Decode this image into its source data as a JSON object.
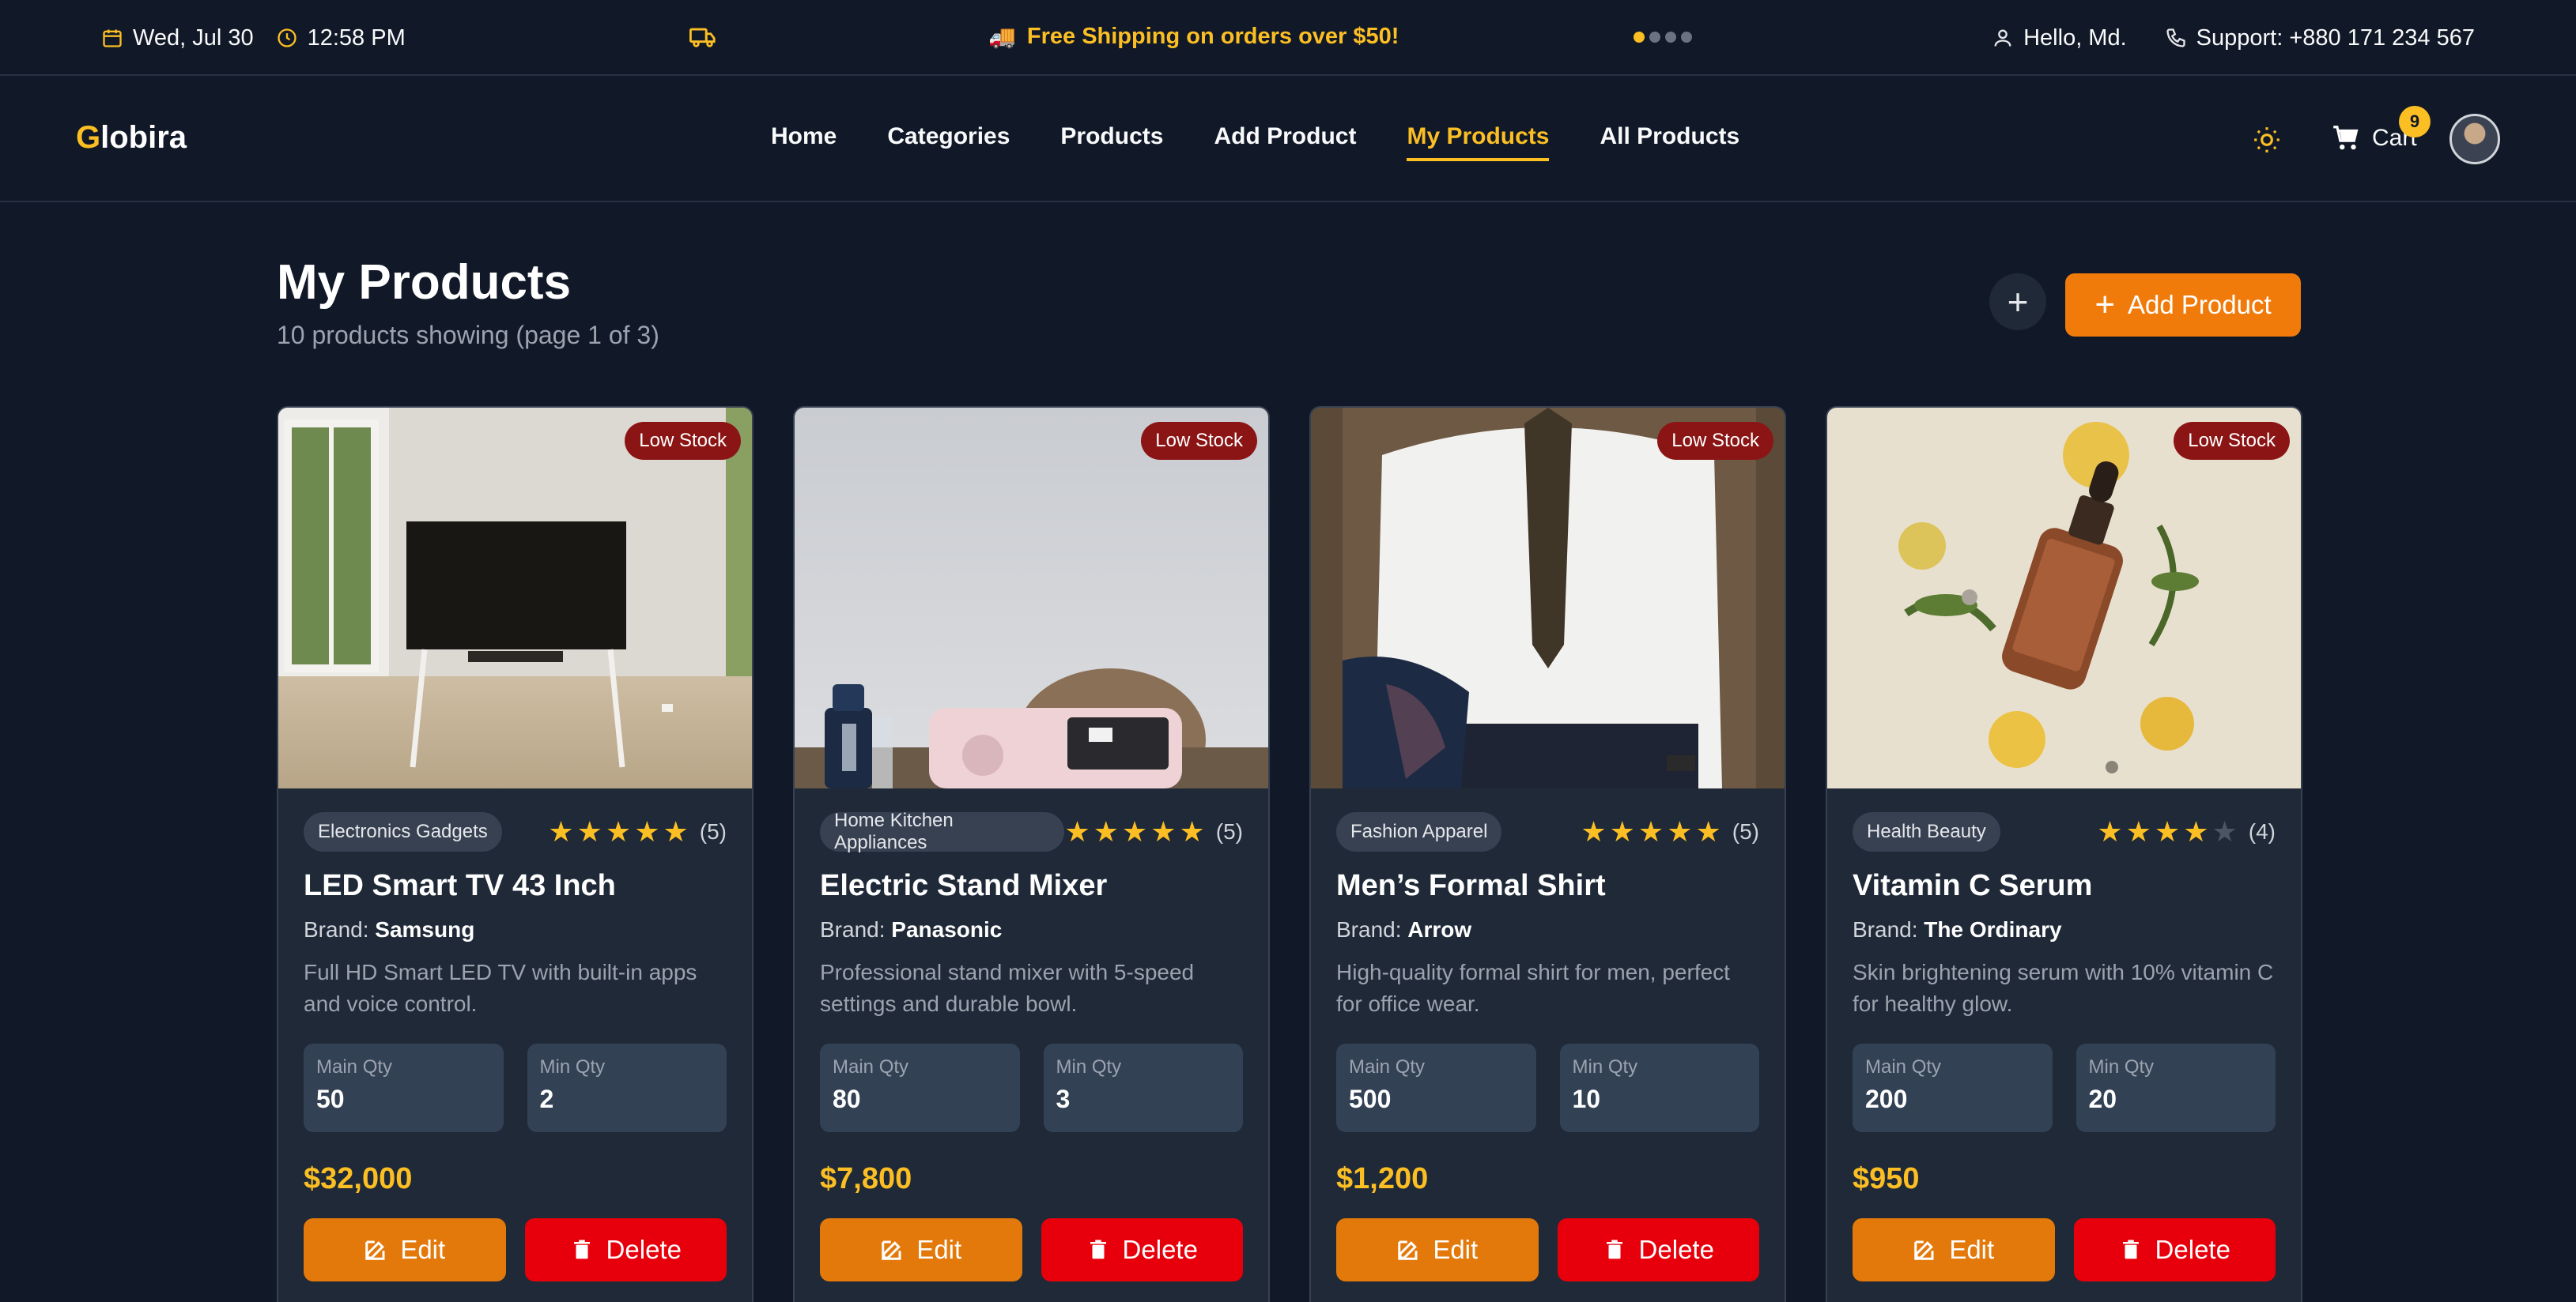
{
  "topbar": {
    "date": "Wed, Jul 30",
    "time": "12:58 PM",
    "promo": "Free Shipping on orders over $50!",
    "greeting": "Hello, Md.",
    "support": "Support: +880 171 234 567"
  },
  "navbar": {
    "logo_first": "G",
    "logo_rest": "lobira",
    "links": [
      "Home",
      "Categories",
      "Products",
      "Add Product",
      "My Products",
      "All Products"
    ],
    "active_link": "My Products",
    "cart_label": "Cart",
    "cart_count": "9"
  },
  "header": {
    "title": "My Products",
    "subtitle": "10 products showing (page 1 of 3)",
    "add_label": "Add Product",
    "plus_symbol": "+"
  },
  "labels": {
    "low_stock": "Low Stock",
    "brand_prefix": "Brand:",
    "main_qty": "Main Qty",
    "min_qty": "Min Qty",
    "edit": "Edit",
    "delete": "Delete"
  },
  "products": [
    {
      "category": "Electronics Gadgets",
      "rating": 5,
      "rating_text": "(5)",
      "title": "LED Smart TV 43 Inch",
      "brand": "Samsung",
      "description": "Full HD Smart LED TV with built-in apps and voice control.",
      "main_qty": "50",
      "min_qty": "2",
      "price": "$32,000"
    },
    {
      "category": "Home Kitchen Appliances",
      "rating": 5,
      "rating_text": "(5)",
      "title": "Electric Stand Mixer",
      "brand": "Panasonic",
      "description": "Professional stand mixer with 5-speed settings and durable bowl.",
      "main_qty": "80",
      "min_qty": "3",
      "price": "$7,800"
    },
    {
      "category": "Fashion Apparel",
      "rating": 5,
      "rating_text": "(5)",
      "title": "Men’s Formal Shirt",
      "brand": "Arrow",
      "description": "High-quality formal shirt for men, perfect for office wear.",
      "main_qty": "500",
      "min_qty": "10",
      "price": "$1,200"
    },
    {
      "category": "Health Beauty",
      "rating": 4,
      "rating_text": "(4)",
      "title": "Vitamin C Serum",
      "brand": "The Ordinary",
      "description": "Skin brightening serum with 10% vitamin C for healthy glow.",
      "main_qty": "200",
      "min_qty": "20",
      "price": "$950"
    }
  ],
  "colors": {
    "accent": "#fbbf24",
    "edit": "#e3790a",
    "delete": "#e7000b",
    "low_stock": "#8b1515",
    "background": "#111827",
    "card": "#1f2937"
  }
}
